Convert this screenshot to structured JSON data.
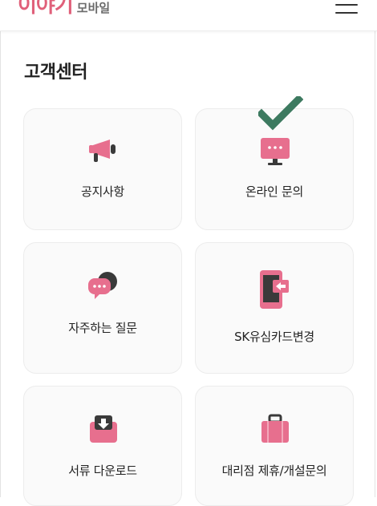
{
  "header": {
    "logo_main": "이야기",
    "logo_sub": "모바일",
    "menu_icon": "hamburger-menu-icon"
  },
  "page": {
    "title": "고객센터"
  },
  "cards": [
    {
      "label": "공지사항",
      "icon": "megaphone-icon"
    },
    {
      "label": "온라인 문의",
      "icon": "monitor-chat-icon",
      "checked": true
    },
    {
      "label": "자주하는 질문",
      "icon": "chat-bubbles-icon"
    },
    {
      "label": "SK유심카드변경",
      "icon": "phone-sim-icon"
    },
    {
      "label": "서류 다운로드",
      "icon": "download-folder-icon"
    },
    {
      "label": "대리점 제휴/개설문의",
      "icon": "briefcase-icon"
    }
  ],
  "colors": {
    "accent": "#e0607a",
    "icon_pink": "#e76f8e",
    "icon_dark": "#3a3a3a",
    "check_green": "#3d7a60"
  }
}
